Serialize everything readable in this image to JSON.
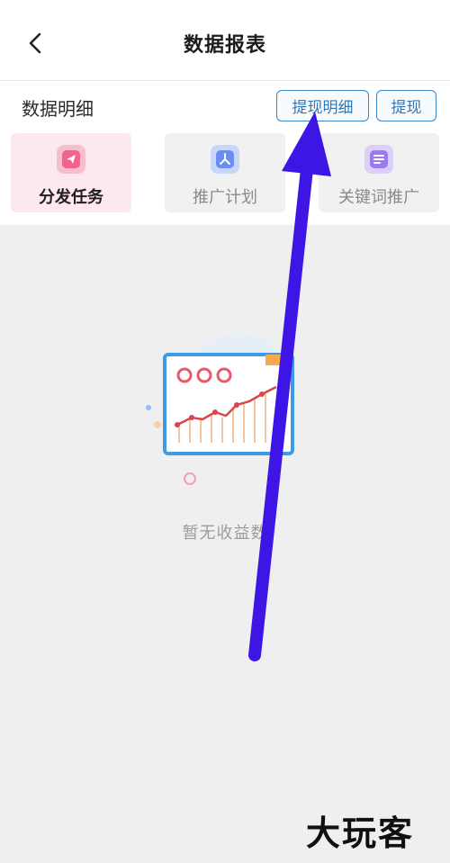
{
  "header": {
    "title": "数据报表",
    "back_icon": "chevron-left-icon"
  },
  "section": {
    "title": "数据明细",
    "detail_button": "提现明细",
    "withdraw_button": "提现"
  },
  "tabs": [
    {
      "label": "分发任务",
      "icon": "paper-plane-icon",
      "active": true,
      "color": "#f2648a"
    },
    {
      "label": "推广计划",
      "icon": "network-icon",
      "active": false,
      "color": "#6b8cf2"
    },
    {
      "label": "关键词推广",
      "icon": "document-icon",
      "active": false,
      "color": "#9b7cf0"
    }
  ],
  "empty_state": {
    "text": "暂无收益数"
  },
  "colors": {
    "accent": "#3a86c4",
    "active_tab_bg": "#fde8ee",
    "annotation_arrow": "#3d16e6"
  },
  "watermark": {
    "text": "大玩客"
  }
}
